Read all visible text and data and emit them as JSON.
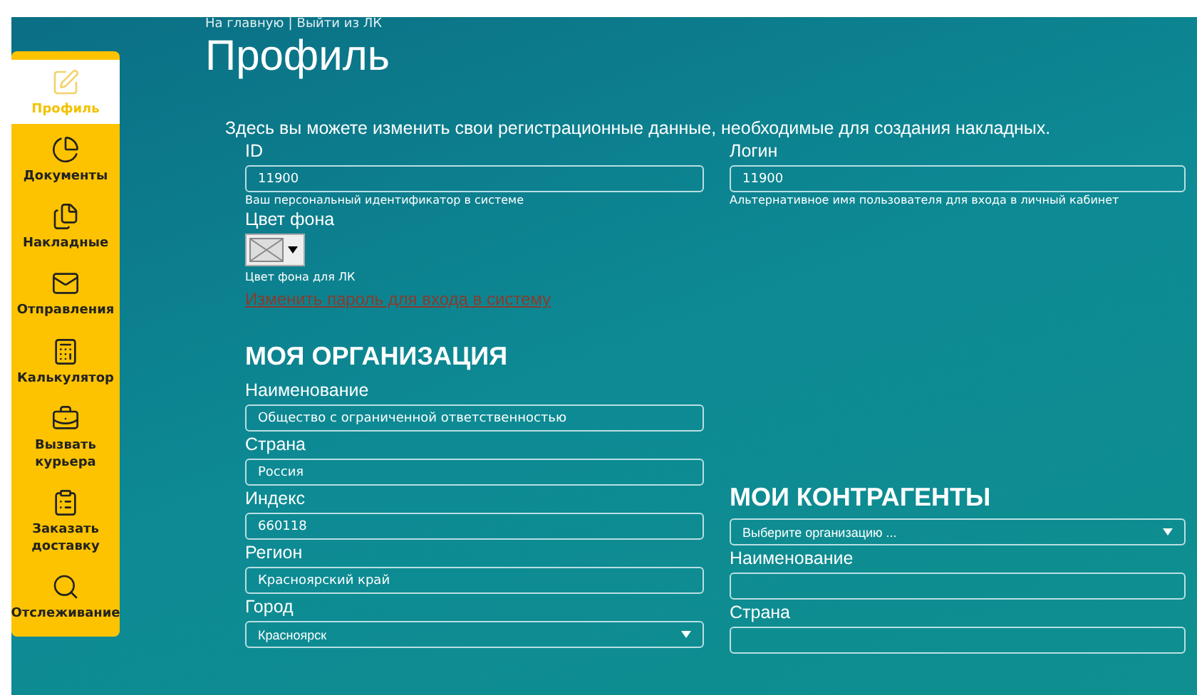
{
  "top_links": [
    {
      "label": "На главную"
    },
    {
      "label": "Выйти из ЛК"
    }
  ],
  "top_separator": "|",
  "title": "Профиль",
  "sidebar": {
    "items": [
      {
        "label": "Профиль",
        "selected": true
      },
      {
        "label": "Документы",
        "selected": false
      },
      {
        "label": "Накладные",
        "selected": false
      },
      {
        "label": "Отправления",
        "selected": false
      },
      {
        "label": "Калькулятор",
        "selected": false
      },
      {
        "label": "Вызвать курьера",
        "selected": false
      },
      {
        "label": "Заказать доставку",
        "selected": false
      },
      {
        "label": "Отслеживание",
        "selected": false
      }
    ]
  },
  "intro": "Здесь вы можете изменить свои регистрационные данные, необходимые для создания накладных.",
  "account": {
    "id": {
      "label": "ID",
      "value": "11900",
      "hint": "Ваш персональный идентификатор в системе"
    },
    "login": {
      "label": "Логин",
      "value": "11900",
      "hint": "Альтернативное имя пользователя для входа в личный кабинет"
    },
    "background": {
      "label": "Цвет фона",
      "hint": "Цвет фона для ЛК"
    },
    "password_link": "Изменить пароль для входа в систему"
  },
  "organization": {
    "heading": "МОЯ ОРГАНИЗАЦИЯ",
    "fields": [
      {
        "label": "Наименование",
        "value": "Общество с ограниченной ответственностью",
        "kind": "text"
      },
      {
        "label": "Страна",
        "value": "Россия",
        "kind": "text"
      },
      {
        "label": "Индекс",
        "value": "660118",
        "kind": "text"
      },
      {
        "label": "Регион",
        "value": "Красноярский край",
        "kind": "text"
      },
      {
        "label": "Город",
        "value": "Красноярск",
        "kind": "select"
      }
    ]
  },
  "contractors": {
    "heading": "МОИ КОНТРАГЕНТЫ",
    "fields": [
      {
        "value": "Выберите организацию ...",
        "kind": "select"
      },
      {
        "label": "Наименование",
        "kind": "text"
      },
      {
        "label": "Страна",
        "kind": "text"
      }
    ]
  }
}
